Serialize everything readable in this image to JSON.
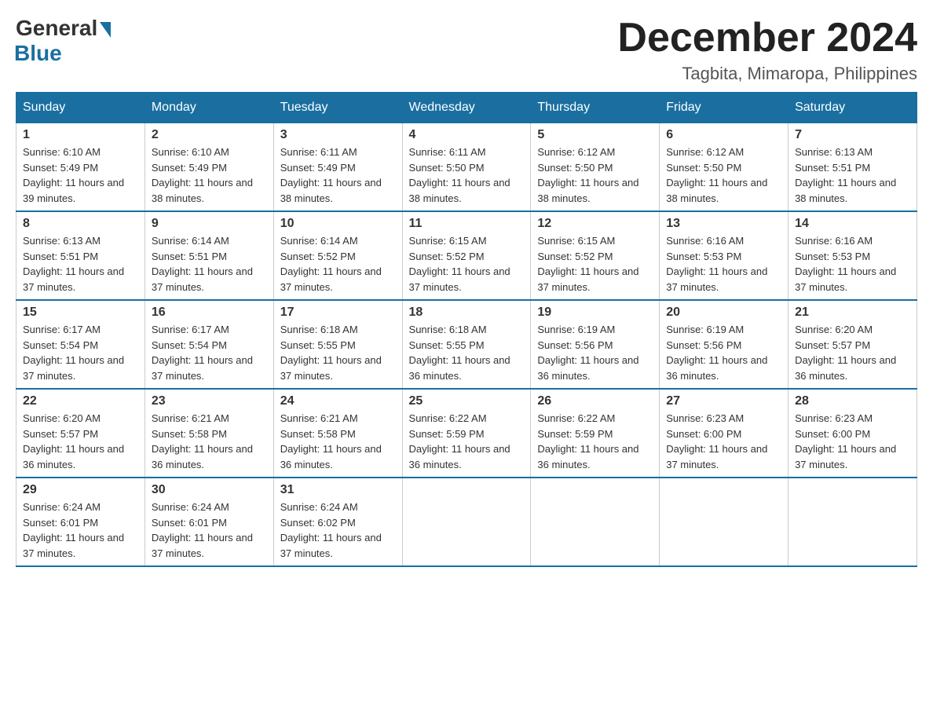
{
  "logo": {
    "general": "General",
    "blue": "Blue"
  },
  "header": {
    "month": "December 2024",
    "location": "Tagbita, Mimaropa, Philippines"
  },
  "days_of_week": [
    "Sunday",
    "Monday",
    "Tuesday",
    "Wednesday",
    "Thursday",
    "Friday",
    "Saturday"
  ],
  "weeks": [
    [
      {
        "day": "1",
        "sunrise": "6:10 AM",
        "sunset": "5:49 PM",
        "daylight": "11 hours and 39 minutes."
      },
      {
        "day": "2",
        "sunrise": "6:10 AM",
        "sunset": "5:49 PM",
        "daylight": "11 hours and 38 minutes."
      },
      {
        "day": "3",
        "sunrise": "6:11 AM",
        "sunset": "5:49 PM",
        "daylight": "11 hours and 38 minutes."
      },
      {
        "day": "4",
        "sunrise": "6:11 AM",
        "sunset": "5:50 PM",
        "daylight": "11 hours and 38 minutes."
      },
      {
        "day": "5",
        "sunrise": "6:12 AM",
        "sunset": "5:50 PM",
        "daylight": "11 hours and 38 minutes."
      },
      {
        "day": "6",
        "sunrise": "6:12 AM",
        "sunset": "5:50 PM",
        "daylight": "11 hours and 38 minutes."
      },
      {
        "day": "7",
        "sunrise": "6:13 AM",
        "sunset": "5:51 PM",
        "daylight": "11 hours and 38 minutes."
      }
    ],
    [
      {
        "day": "8",
        "sunrise": "6:13 AM",
        "sunset": "5:51 PM",
        "daylight": "11 hours and 37 minutes."
      },
      {
        "day": "9",
        "sunrise": "6:14 AM",
        "sunset": "5:51 PM",
        "daylight": "11 hours and 37 minutes."
      },
      {
        "day": "10",
        "sunrise": "6:14 AM",
        "sunset": "5:52 PM",
        "daylight": "11 hours and 37 minutes."
      },
      {
        "day": "11",
        "sunrise": "6:15 AM",
        "sunset": "5:52 PM",
        "daylight": "11 hours and 37 minutes."
      },
      {
        "day": "12",
        "sunrise": "6:15 AM",
        "sunset": "5:52 PM",
        "daylight": "11 hours and 37 minutes."
      },
      {
        "day": "13",
        "sunrise": "6:16 AM",
        "sunset": "5:53 PM",
        "daylight": "11 hours and 37 minutes."
      },
      {
        "day": "14",
        "sunrise": "6:16 AM",
        "sunset": "5:53 PM",
        "daylight": "11 hours and 37 minutes."
      }
    ],
    [
      {
        "day": "15",
        "sunrise": "6:17 AM",
        "sunset": "5:54 PM",
        "daylight": "11 hours and 37 minutes."
      },
      {
        "day": "16",
        "sunrise": "6:17 AM",
        "sunset": "5:54 PM",
        "daylight": "11 hours and 37 minutes."
      },
      {
        "day": "17",
        "sunrise": "6:18 AM",
        "sunset": "5:55 PM",
        "daylight": "11 hours and 37 minutes."
      },
      {
        "day": "18",
        "sunrise": "6:18 AM",
        "sunset": "5:55 PM",
        "daylight": "11 hours and 36 minutes."
      },
      {
        "day": "19",
        "sunrise": "6:19 AM",
        "sunset": "5:56 PM",
        "daylight": "11 hours and 36 minutes."
      },
      {
        "day": "20",
        "sunrise": "6:19 AM",
        "sunset": "5:56 PM",
        "daylight": "11 hours and 36 minutes."
      },
      {
        "day": "21",
        "sunrise": "6:20 AM",
        "sunset": "5:57 PM",
        "daylight": "11 hours and 36 minutes."
      }
    ],
    [
      {
        "day": "22",
        "sunrise": "6:20 AM",
        "sunset": "5:57 PM",
        "daylight": "11 hours and 36 minutes."
      },
      {
        "day": "23",
        "sunrise": "6:21 AM",
        "sunset": "5:58 PM",
        "daylight": "11 hours and 36 minutes."
      },
      {
        "day": "24",
        "sunrise": "6:21 AM",
        "sunset": "5:58 PM",
        "daylight": "11 hours and 36 minutes."
      },
      {
        "day": "25",
        "sunrise": "6:22 AM",
        "sunset": "5:59 PM",
        "daylight": "11 hours and 36 minutes."
      },
      {
        "day": "26",
        "sunrise": "6:22 AM",
        "sunset": "5:59 PM",
        "daylight": "11 hours and 36 minutes."
      },
      {
        "day": "27",
        "sunrise": "6:23 AM",
        "sunset": "6:00 PM",
        "daylight": "11 hours and 37 minutes."
      },
      {
        "day": "28",
        "sunrise": "6:23 AM",
        "sunset": "6:00 PM",
        "daylight": "11 hours and 37 minutes."
      }
    ],
    [
      {
        "day": "29",
        "sunrise": "6:24 AM",
        "sunset": "6:01 PM",
        "daylight": "11 hours and 37 minutes."
      },
      {
        "day": "30",
        "sunrise": "6:24 AM",
        "sunset": "6:01 PM",
        "daylight": "11 hours and 37 minutes."
      },
      {
        "day": "31",
        "sunrise": "6:24 AM",
        "sunset": "6:02 PM",
        "daylight": "11 hours and 37 minutes."
      },
      null,
      null,
      null,
      null
    ]
  ],
  "labels": {
    "sunrise": "Sunrise:",
    "sunset": "Sunset:",
    "daylight": "Daylight:"
  }
}
